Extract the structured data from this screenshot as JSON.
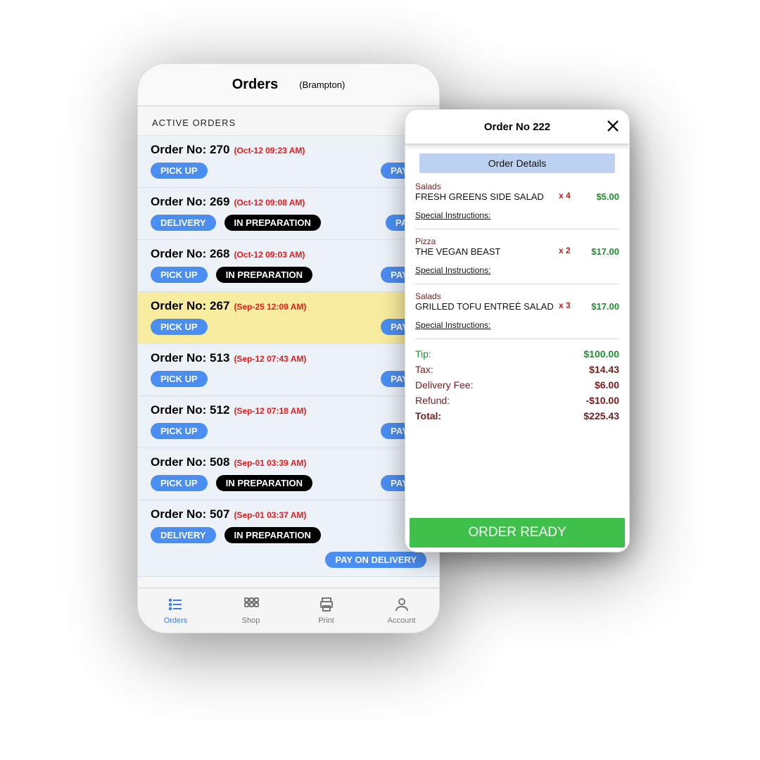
{
  "back": {
    "header": {
      "title": "Orders",
      "location": "(Brampton)"
    },
    "section_label": "ACTIVE ORDERS",
    "orders": [
      {
        "no": "Order No: 270",
        "ts": "(Oct-12 09:23 AM)",
        "chips": [
          "PICK UP"
        ],
        "right": "PAY A",
        "highlight": false
      },
      {
        "no": "Order No: 269",
        "ts": "(Oct-12 09:08 AM)",
        "chips": [
          "DELIVERY",
          "IN PREPARATION"
        ],
        "right": "PAID",
        "highlight": false
      },
      {
        "no": "Order No: 268",
        "ts": "(Oct-12 09:03 AM)",
        "chips": [
          "PICK UP",
          "IN PREPARATION"
        ],
        "right": "PAY A",
        "highlight": false
      },
      {
        "no": "Order No: 267",
        "ts": "(Sep-25 12:09 AM)",
        "chips": [
          "PICK UP"
        ],
        "right": "PAY A",
        "highlight": true
      },
      {
        "no": "Order No: 513",
        "ts": "(Sep-12 07:43 AM)",
        "chips": [
          "PICK UP"
        ],
        "right": "PAY A",
        "highlight": false
      },
      {
        "no": "Order No: 512",
        "ts": "(Sep-12 07:18 AM)",
        "chips": [
          "PICK UP"
        ],
        "right": "PAY A",
        "highlight": false
      },
      {
        "no": "Order No: 508",
        "ts": "(Sep-01 03:39 AM)",
        "chips": [
          "PICK UP",
          "IN PREPARATION"
        ],
        "right": "PAY A",
        "highlight": false
      },
      {
        "no": "Order No: 507",
        "ts": "(Sep-01 03:37 AM)",
        "chips": [
          "DELIVERY",
          "IN PREPARATION"
        ],
        "right": "PAY ON DELIVERY",
        "highlight": false
      }
    ],
    "tabs": [
      {
        "label": "Orders",
        "icon": "list-icon",
        "active": true
      },
      {
        "label": "Shop",
        "icon": "grid-icon",
        "active": false
      },
      {
        "label": "Print",
        "icon": "printer-icon",
        "active": false
      },
      {
        "label": "Account",
        "icon": "person-icon",
        "active": false
      }
    ]
  },
  "front": {
    "title": "Order No 222",
    "details_band": "Order Details",
    "special_label": "Special Instructions:",
    "items": [
      {
        "category": "Salads",
        "name": "FRESH GREENS SIDE SALAD",
        "qty": "x 4",
        "price": "$5.00"
      },
      {
        "category": "Pizza",
        "name": "THE VEGAN BEAST",
        "qty": "x 2",
        "price": "$17.00"
      },
      {
        "category": "Salads",
        "name": "GRILLED TOFU ENTREÉ SALAD",
        "qty": "x 3",
        "price": "$17.00"
      }
    ],
    "totals": {
      "tip": {
        "label": "Tip:",
        "value": "$100.00"
      },
      "tax": {
        "label": "Tax:",
        "value": "$14.43"
      },
      "delivery": {
        "label": "Delivery Fee:",
        "value": "$6.00"
      },
      "refund": {
        "label": "Refund:",
        "value": "-$10.00"
      },
      "total": {
        "label": "Total:",
        "value": "$225.43"
      }
    },
    "ready_button": "ORDER READY"
  }
}
